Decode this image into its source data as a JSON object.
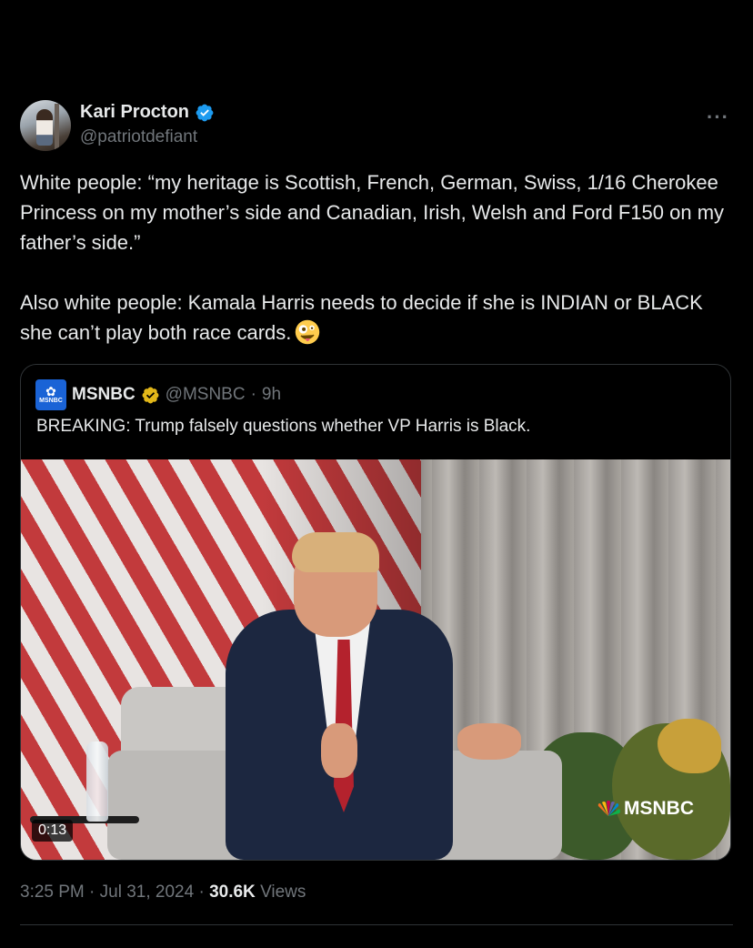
{
  "author": {
    "display_name": "Kari Procton",
    "handle": "@patriotdefiant",
    "verified_icon": "verified-badge-icon",
    "more_label": "···"
  },
  "tweet": {
    "paragraph1": "White people: “my heritage is Scottish, French, German, Swiss, 1/16 Cherokee Princess on my mother’s side and Canadian, Irish, Welsh and Ford F150 on my father’s side.”",
    "paragraph2": "Also white people: Kamala Harris needs to decide if she is INDIAN or BLACK she can’t play both race cards.",
    "emoji": "zany-face-emoji"
  },
  "quote": {
    "display_name": "MSNBC",
    "avatar_text": "MSNBC",
    "handle": "@MSNBC",
    "separator": "·",
    "time": "9h",
    "text": "BREAKING: Trump falsely questions whether VP Harris is Black.",
    "video": {
      "duration": "0:13",
      "watermark": "MSNBC"
    }
  },
  "footer": {
    "time": "3:25 PM",
    "sep1": "·",
    "date": "Jul 31, 2024",
    "sep2": "·",
    "views_count": "30.6K",
    "views_label": "Views"
  },
  "colors": {
    "background": "#000000",
    "text": "#e7e9ea",
    "muted": "#71767b",
    "verified_blue": "#1d9bf0",
    "verified_gold": "#e2b719",
    "border": "#2f3336"
  }
}
